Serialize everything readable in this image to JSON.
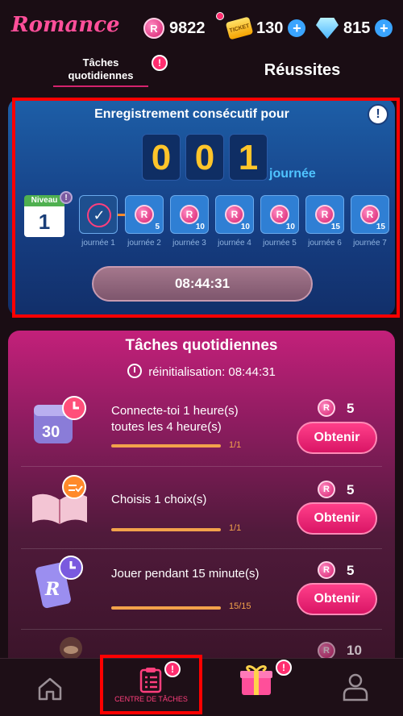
{
  "header": {
    "logo": "Romance",
    "coins": "9822",
    "tickets": "130",
    "diamonds": "815",
    "coin_glyph": "R",
    "ticket_glyph": "TICKET"
  },
  "tabs": {
    "daily": "Tâches quotidiennes",
    "success": "Réussites",
    "alert": "!"
  },
  "streak": {
    "title": "Enregistrement consécutif pour",
    "digits": [
      "0",
      "0",
      "1"
    ],
    "unit": "journée",
    "level_label": "Niveau",
    "level_value": "1",
    "days": [
      {
        "label": "journée 1",
        "amount": ""
      },
      {
        "label": "journée 2",
        "amount": "5"
      },
      {
        "label": "journée 3",
        "amount": "10"
      },
      {
        "label": "journée 4",
        "amount": "10"
      },
      {
        "label": "journée 5",
        "amount": "10"
      },
      {
        "label": "journée 6",
        "amount": "15"
      },
      {
        "label": "journée 7",
        "amount": "15"
      }
    ],
    "timer": "08:44:31"
  },
  "tasks": {
    "title": "Tâches quotidiennes",
    "reset_label": "réinitialisation:",
    "reset_time": "08:44:31",
    "obtain_label": "Obtenir",
    "items": [
      {
        "text": "Connecte-toi 1 heure(s) toutes les 4 heure(s)",
        "progress": "1/1",
        "reward": "5",
        "icon_text": "30"
      },
      {
        "text": "Choisis 1 choix(s)",
        "progress": "1/1",
        "reward": "5"
      },
      {
        "text": "Jouer pendant 15 minute(s)",
        "progress": "15/15",
        "reward": "5"
      },
      {
        "text": "",
        "progress": "",
        "reward": "10"
      }
    ]
  },
  "nav": {
    "tasks_label": "CENTRE DE TÂCHES"
  }
}
